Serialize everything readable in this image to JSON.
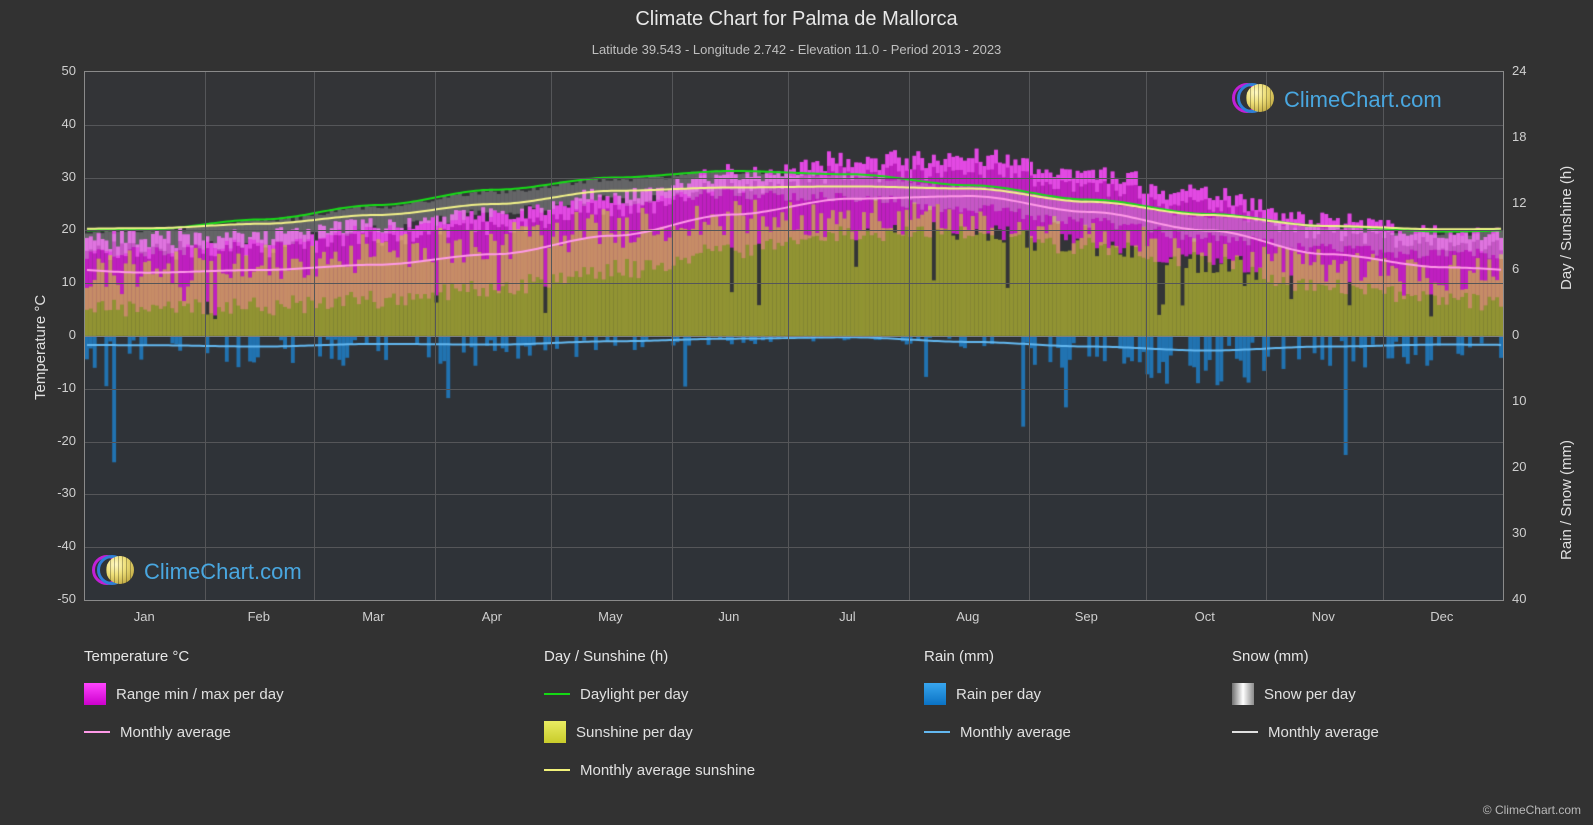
{
  "header": {
    "title": "Climate Chart for Palma de Mallorca",
    "subtitle": "Latitude 39.543 - Longitude 2.742 - Elevation 11.0 - Period 2013 - 2023"
  },
  "branding": {
    "logo_text_1": "Clime",
    "logo_text_2": "Chart.com",
    "copyright": "© ClimeChart.com"
  },
  "legend": {
    "columns": [
      {
        "title": "Temperature °C",
        "items": [
          {
            "label": "Range min / max per day",
            "type": "box",
            "color": "#e81ee8"
          },
          {
            "label": "Monthly average",
            "type": "line",
            "color": "#ff9ae8"
          }
        ]
      },
      {
        "title": "Day / Sunshine (h)",
        "items": [
          {
            "label": "Daylight per day",
            "type": "line",
            "color": "#14d814"
          },
          {
            "label": "Sunshine per day",
            "type": "box",
            "color": "#d9dc3c"
          },
          {
            "label": "Monthly average sunshine",
            "type": "line",
            "color": "#f2f27a"
          }
        ]
      },
      {
        "title": "Rain (mm)",
        "items": [
          {
            "label": "Rain per day",
            "type": "box",
            "color": "#1a8fe0"
          },
          {
            "label": "Monthly average",
            "type": "line",
            "color": "#63b8f0"
          }
        ]
      },
      {
        "title": "Snow (mm)",
        "items": [
          {
            "label": "Snow per day",
            "type": "box",
            "color": "#e8e8e8"
          },
          {
            "label": "Monthly average",
            "type": "line",
            "color": "#e0e0e0"
          }
        ]
      }
    ]
  },
  "chart_data": {
    "type": "area",
    "title": "Climate Chart for Palma de Mallorca",
    "subtitle": "Latitude 39.543 - Longitude 2.742 - Elevation 11.0 - Period 2013 - 2023",
    "grid": true,
    "legend_position": "below",
    "xlabel": "",
    "x_tick_labels": [
      "Jan",
      "Feb",
      "Mar",
      "Apr",
      "May",
      "Jun",
      "Jul",
      "Aug",
      "Sep",
      "Oct",
      "Nov",
      "Dec"
    ],
    "axes": {
      "left": {
        "label": "Temperature °C",
        "ylim": [
          -50,
          50
        ],
        "ticks": [
          -50,
          -40,
          -30,
          -20,
          -10,
          0,
          10,
          20,
          30,
          40,
          50
        ],
        "tick_labels": [
          "-50",
          "-40",
          "-30",
          "-20",
          "-10",
          "0",
          "10",
          "20",
          "30",
          "40",
          "50"
        ]
      },
      "right_upper": {
        "label": "Day / Sunshine (h)",
        "ylim": [
          0,
          24
        ],
        "ticks": [
          0,
          6,
          12,
          18,
          24
        ],
        "tick_labels": [
          "0",
          "6",
          "12",
          "18",
          "24"
        ]
      },
      "right_lower": {
        "label": "Rain / Snow (mm)",
        "ylim": [
          0,
          40
        ],
        "ticks": [
          0,
          10,
          20,
          30,
          40
        ],
        "tick_labels": [
          "0",
          "10",
          "20",
          "30",
          "40"
        ]
      }
    },
    "categories": [
      "Jan",
      "Feb",
      "Mar",
      "Apr",
      "May",
      "Jun",
      "Jul",
      "Aug",
      "Sep",
      "Oct",
      "Nov",
      "Dec"
    ],
    "series": [
      {
        "name": "Monthly average temperature (°C)",
        "axis": "left",
        "color": "#ff9ae8",
        "values": [
          12.0,
          12.5,
          13.5,
          15.5,
          19.0,
          23.0,
          26.0,
          26.5,
          23.5,
          20.0,
          15.5,
          13.0
        ]
      },
      {
        "name": "Monthly average max temperature (°C)",
        "axis": "left",
        "color": "#e81ee8",
        "values": [
          16.0,
          16.5,
          18.5,
          20.5,
          24.0,
          28.0,
          31.0,
          31.5,
          28.0,
          24.5,
          19.5,
          16.5
        ]
      },
      {
        "name": "Monthly average min temperature (°C)",
        "axis": "left",
        "color": "#e81ee8",
        "values": [
          7.5,
          7.5,
          9.0,
          11.0,
          14.5,
          18.5,
          21.5,
          22.0,
          19.0,
          16.0,
          11.5,
          9.0
        ]
      },
      {
        "name": "Daylight per day (h)",
        "axis": "right_upper",
        "color": "#14d814",
        "values": [
          9.7,
          10.6,
          11.9,
          13.3,
          14.4,
          15.0,
          14.7,
          13.7,
          12.4,
          11.1,
          10.0,
          9.5
        ]
      },
      {
        "name": "Monthly average sunshine (h)",
        "axis": "right_upper",
        "color": "#f2f27a",
        "values": [
          9.8,
          10.2,
          11.0,
          12.0,
          13.2,
          13.5,
          13.6,
          13.4,
          12.2,
          11.0,
          10.0,
          9.7
        ]
      },
      {
        "name": "Sunshine per day (h)",
        "axis": "right_upper",
        "color": "#d9dc3c",
        "values": [
          6.0,
          6.6,
          7.5,
          8.5,
          9.8,
          10.6,
          10.8,
          10.2,
          8.9,
          7.2,
          6.2,
          5.8
        ]
      },
      {
        "name": "Rain monthly average (mm)",
        "axis": "right_lower",
        "color": "#63b8f0",
        "values": [
          1.4,
          1.6,
          1.2,
          1.3,
          0.8,
          0.4,
          0.2,
          0.9,
          1.6,
          2.2,
          1.6,
          1.3
        ]
      }
    ]
  }
}
